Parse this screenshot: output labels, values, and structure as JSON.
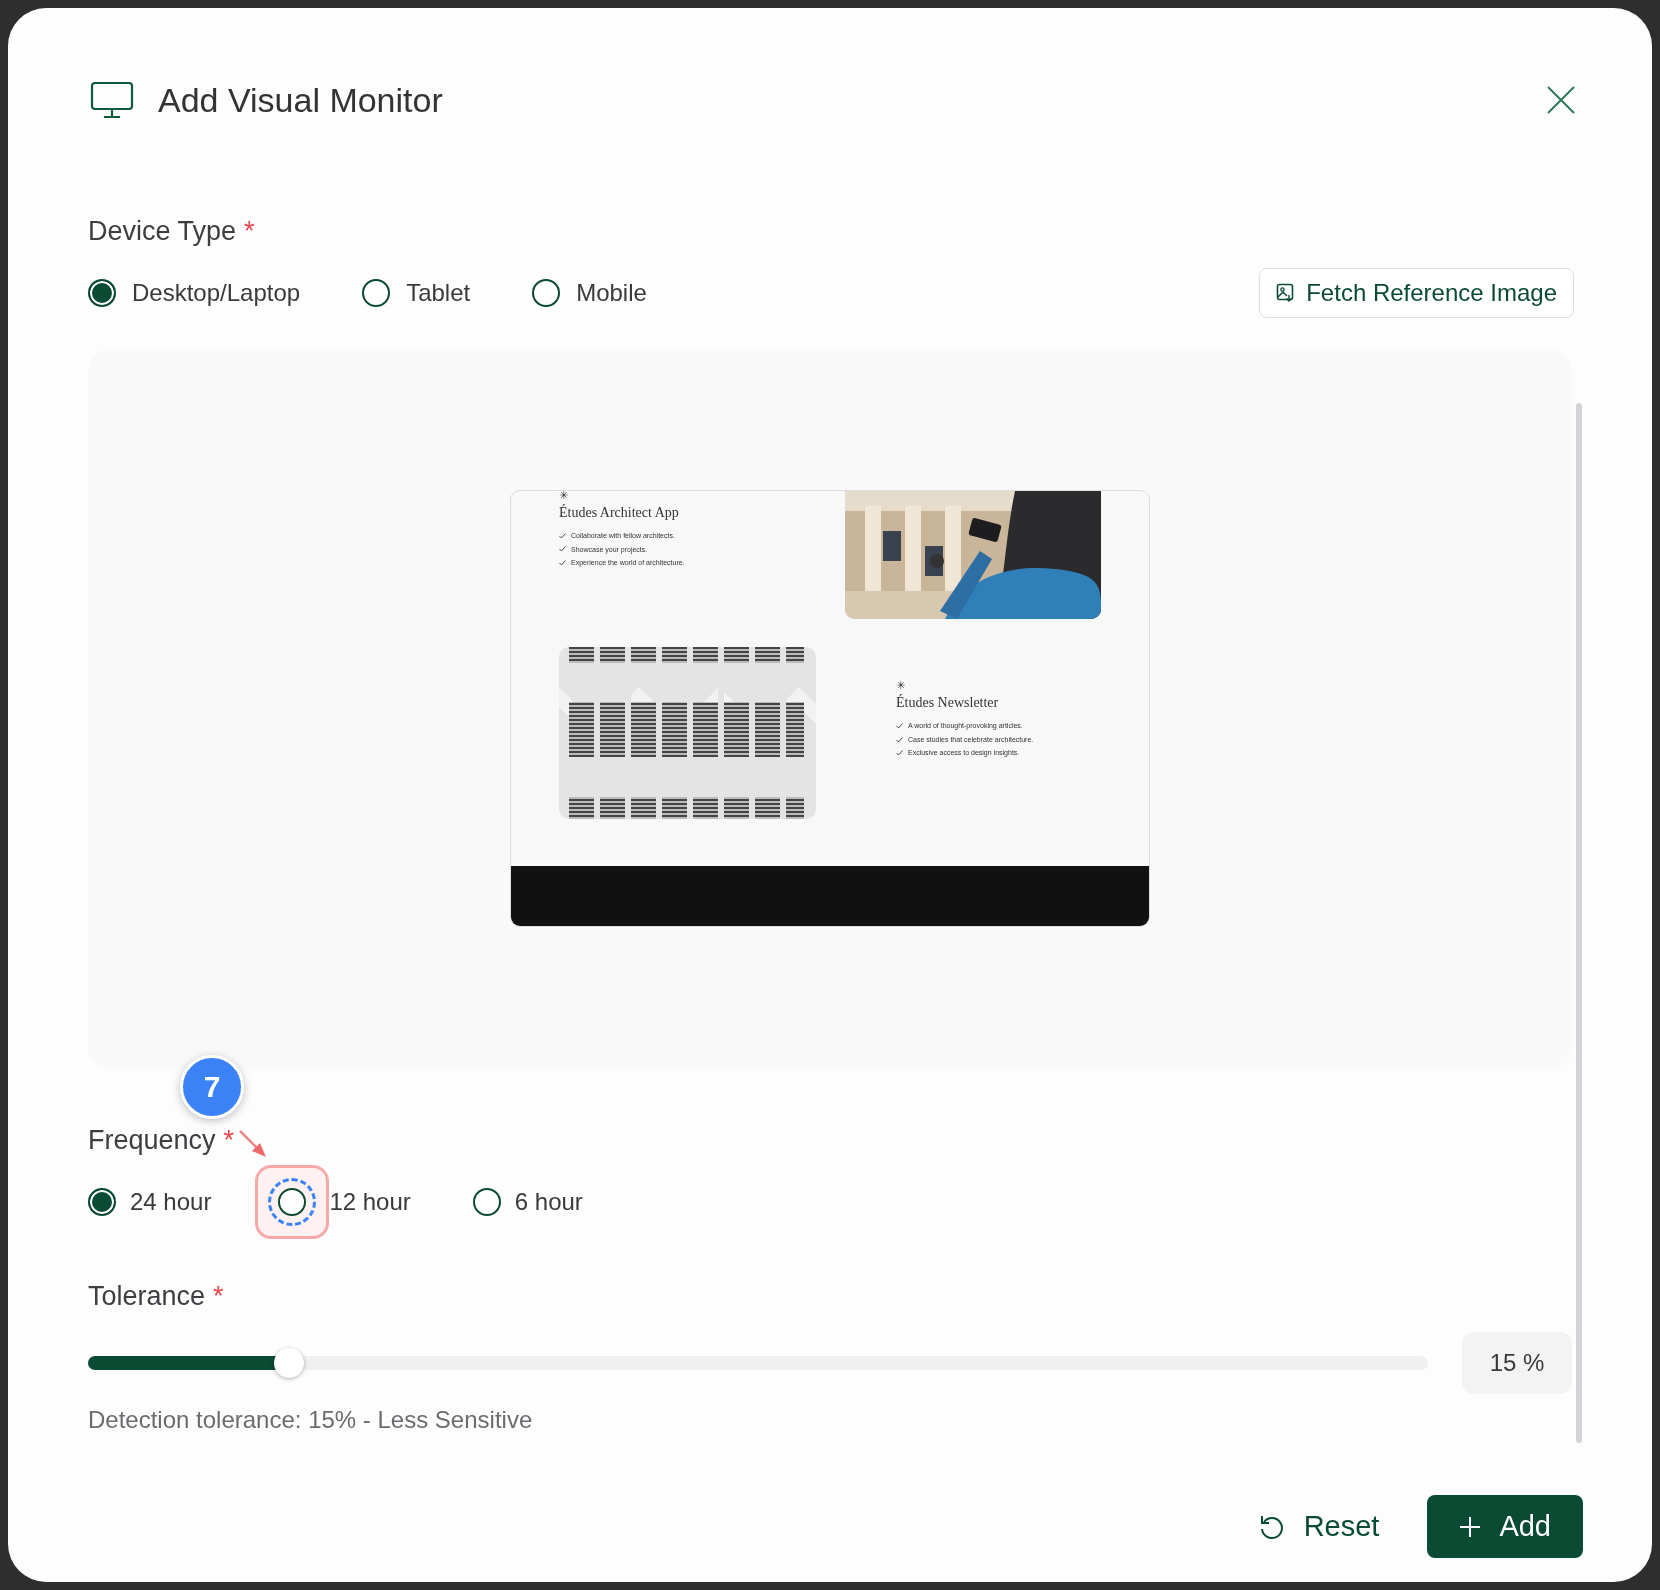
{
  "dialog": {
    "title": "Add Visual Monitor"
  },
  "device_type": {
    "label": "Device Type",
    "required_mark": "*",
    "options": [
      {
        "label": "Desktop/Laptop",
        "selected": true
      },
      {
        "label": "Tablet",
        "selected": false
      },
      {
        "label": "Mobile",
        "selected": false
      }
    ]
  },
  "fetch_button": {
    "label": "Fetch Reference Image"
  },
  "preview": {
    "sections": [
      {
        "mark": "✳",
        "title": "Études Architect App",
        "items": [
          "Collaborate with fellow architects.",
          "Showcase your projects.",
          "Experience the world of architecture."
        ]
      },
      {
        "mark": "✳",
        "title": "Études Newsletter",
        "items": [
          "A world of thought-provoking articles.",
          "Case studies that celebrate architecture.",
          "Exclusive access to design insights."
        ]
      }
    ]
  },
  "frequency": {
    "label": "Frequency",
    "required_mark": "*",
    "options": [
      {
        "label": "24 hour",
        "selected": true
      },
      {
        "label": "12 hour",
        "selected": false
      },
      {
        "label": "6 hour",
        "selected": false
      }
    ]
  },
  "annotation": {
    "badge": "7"
  },
  "tolerance": {
    "label": "Tolerance",
    "required_mark": "*",
    "level": 0.15,
    "value": "15 %",
    "description": "Detection tolerance: 15% - Less Sensitive"
  },
  "buttons": {
    "reset": "Reset",
    "add": "Add"
  }
}
